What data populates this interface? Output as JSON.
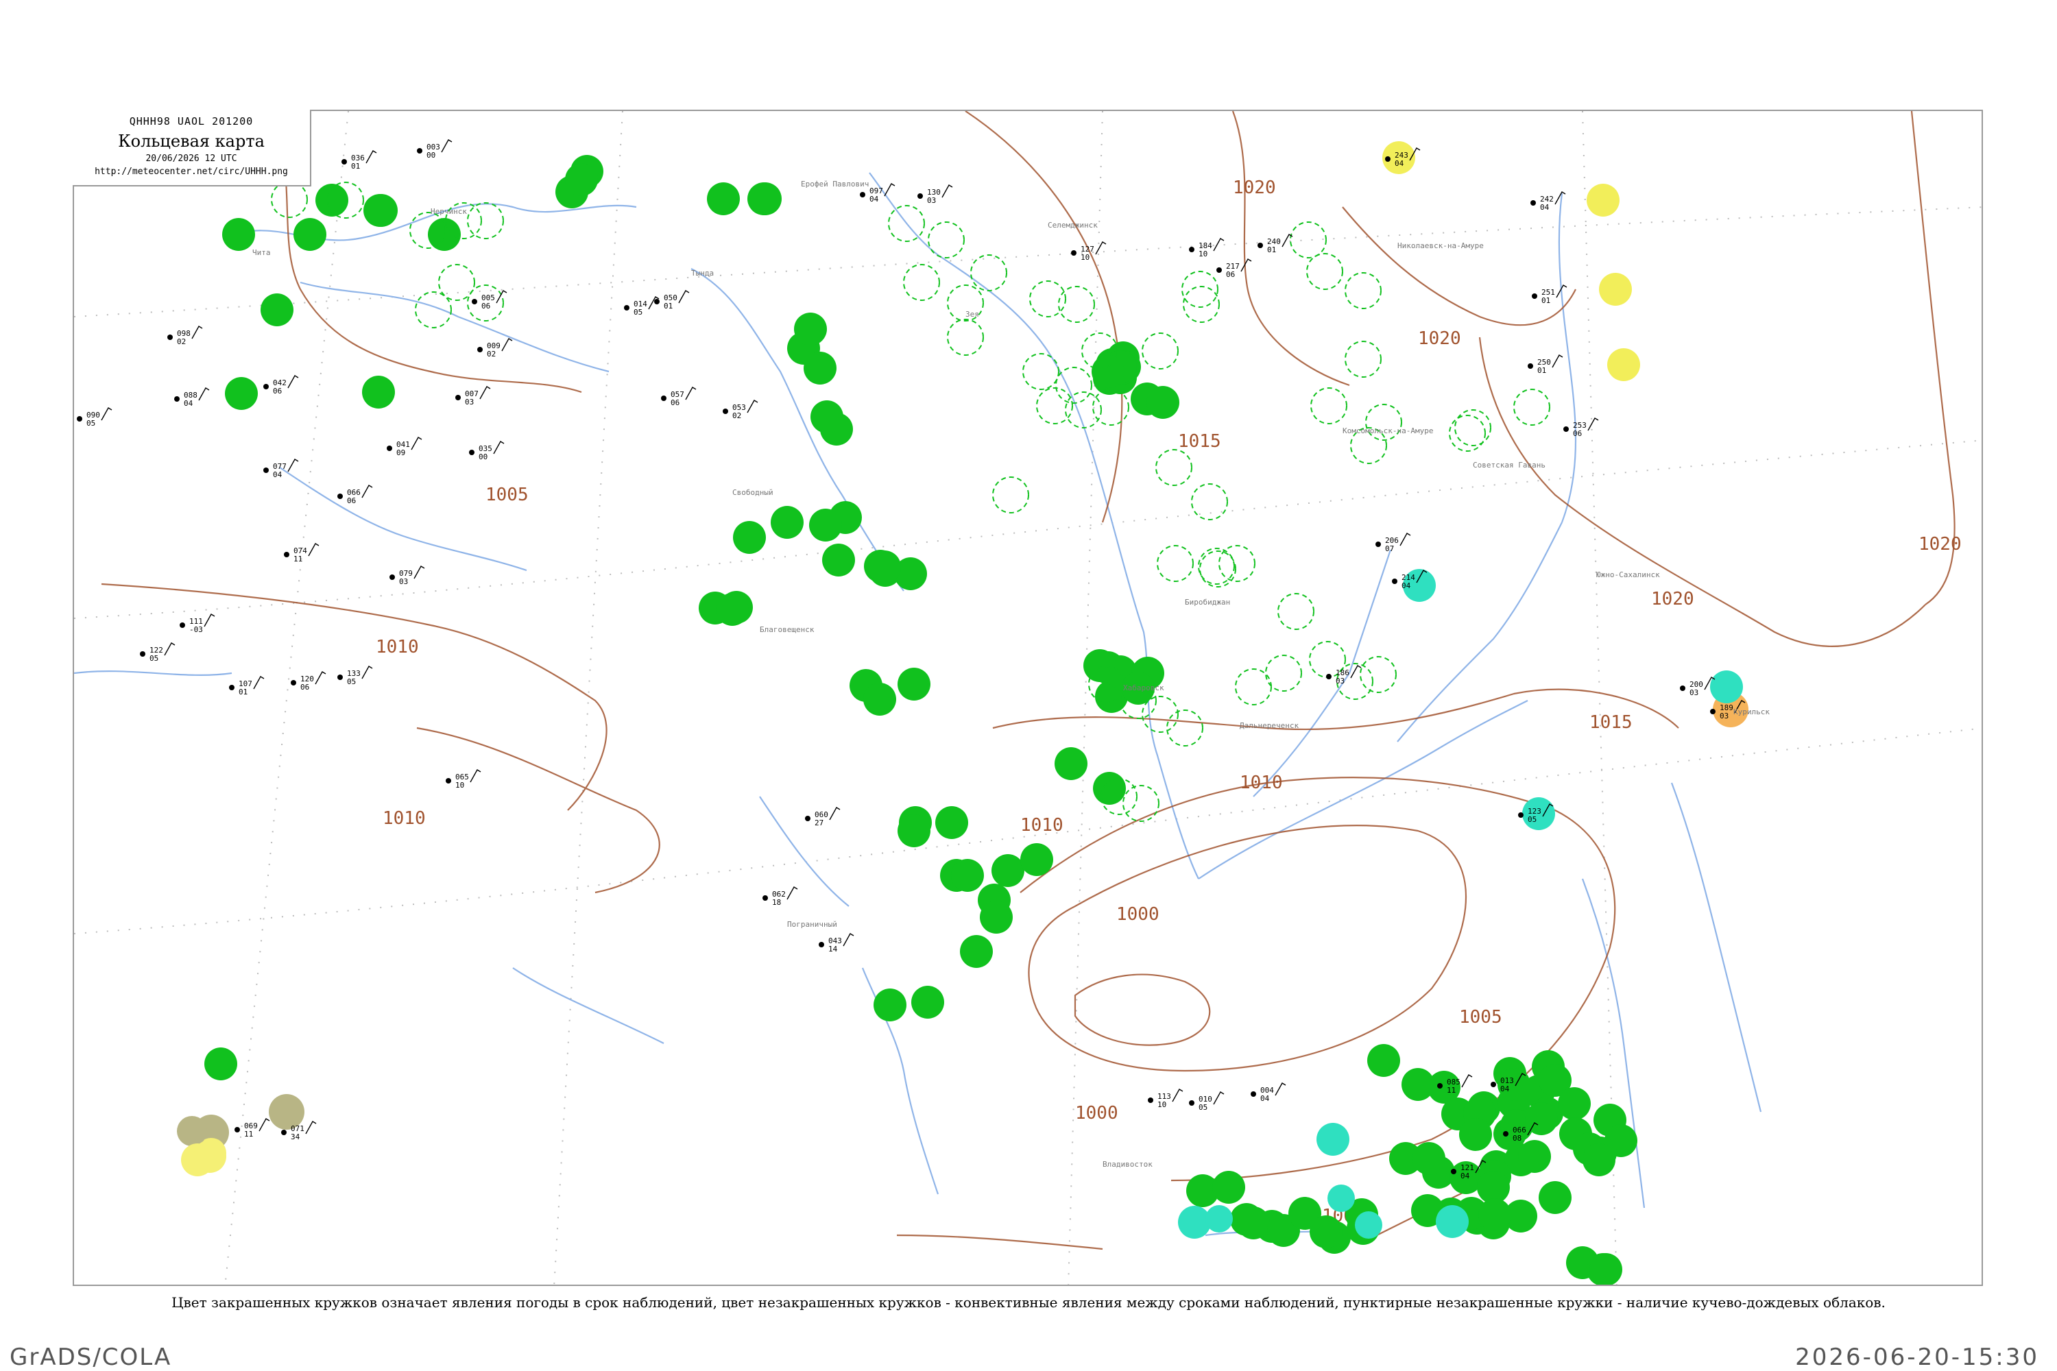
{
  "title": {
    "code": "QHHH98  UAOL  201200",
    "name": "Кольцевая карта",
    "date": "20/06/2026 12 UTC",
    "url": "http://meteocenter.net/circ/UHHH.png"
  },
  "caption": "Цвет закрашенных кружков означает явления погоды в срок наблюдений, цвет незакрашенных кружков - конвективные явления между сроками наблюдений, пунктирные незакрашенные кружки - наличие кучево-дождевых облаков.",
  "footer": {
    "left": "GrADS/COLA",
    "right": "2026-06-20-15:30"
  },
  "colors": {
    "isobar": "#a0522d",
    "river": "#8fb4e8",
    "rain": "#11c11e",
    "shower": "#2fe0c0",
    "fog_yellow": "#f2ee5a",
    "haze_yellow": "#f5f075",
    "dust": "#f5b35a",
    "haze_olive": "#b8b585",
    "convective": "#11c11e"
  },
  "isobars": [
    {
      "label": "1005"
    },
    {
      "label": "1010"
    },
    {
      "label": "1010"
    },
    {
      "label": "1015"
    },
    {
      "label": "1020"
    },
    {
      "label": "1020"
    },
    {
      "label": "1020"
    },
    {
      "label": "1020"
    },
    {
      "label": "1000"
    },
    {
      "label": "1000"
    },
    {
      "label": "1005"
    },
    {
      "label": "1010"
    },
    {
      "label": "1015"
    },
    {
      "label": "1010"
    },
    {
      "label": "1005"
    }
  ],
  "stations": [
    {
      "pressure": "036",
      "tendency": "01"
    },
    {
      "pressure": "005",
      "tendency": "06"
    },
    {
      "pressure": "003",
      "tendency": "00"
    },
    {
      "pressure": "009",
      "tendency": "02"
    },
    {
      "pressure": "098",
      "tendency": "02"
    },
    {
      "pressure": "090",
      "tendency": "05"
    },
    {
      "pressure": "088",
      "tendency": "04"
    },
    {
      "pressure": "042",
      "tendency": "06"
    },
    {
      "pressure": "041",
      "tendency": "09"
    },
    {
      "pressure": "035",
      "tendency": "00"
    },
    {
      "pressure": "007",
      "tendency": "03"
    },
    {
      "pressure": "077",
      "tendency": "04"
    },
    {
      "pressure": "066",
      "tendency": "06"
    },
    {
      "pressure": "074",
      "tendency": "11"
    },
    {
      "pressure": "079",
      "tendency": "03"
    },
    {
      "pressure": "111",
      "tendency": "-03"
    },
    {
      "pressure": "122",
      "tendency": "05"
    },
    {
      "pressure": "133",
      "tendency": "05"
    },
    {
      "pressure": "120",
      "tendency": "06"
    },
    {
      "pressure": "107",
      "tendency": "01"
    },
    {
      "pressure": "065",
      "tendency": "10"
    },
    {
      "pressure": "014",
      "tendency": "05"
    },
    {
      "pressure": "050",
      "tendency": "01"
    },
    {
      "pressure": "057",
      "tendency": "06"
    },
    {
      "pressure": "053",
      "tendency": "02"
    },
    {
      "pressure": "097",
      "tendency": "04"
    },
    {
      "pressure": "130",
      "tendency": "03"
    },
    {
      "pressure": "127",
      "tendency": "10"
    },
    {
      "pressure": "184",
      "tendency": "10"
    },
    {
      "pressure": "240",
      "tendency": "01"
    },
    {
      "pressure": "217",
      "tendency": "06"
    },
    {
      "pressure": "242",
      "tendency": "04"
    },
    {
      "pressure": "243",
      "tendency": "04"
    },
    {
      "pressure": "251",
      "tendency": "01"
    },
    {
      "pressure": "250",
      "tendency": "01"
    },
    {
      "pressure": "253",
      "tendency": "06"
    },
    {
      "pressure": "214",
      "tendency": "04"
    },
    {
      "pressure": "200",
      "tendency": "03"
    },
    {
      "pressure": "189",
      "tendency": "03"
    },
    {
      "pressure": "123",
      "tendency": "05"
    },
    {
      "pressure": "113",
      "tendency": "10"
    },
    {
      "pressure": "010",
      "tendency": "05"
    },
    {
      "pressure": "004",
      "tendency": "04"
    },
    {
      "pressure": "085",
      "tendency": "11"
    },
    {
      "pressure": "013",
      "tendency": "04"
    },
    {
      "pressure": "121",
      "tendency": "04"
    },
    {
      "pressure": "066",
      "tendency": "08"
    },
    {
      "pressure": "069",
      "tendency": "11"
    },
    {
      "pressure": "071",
      "tendency": "34"
    },
    {
      "pressure": "062",
      "tendency": "18"
    },
    {
      "pressure": "060",
      "tendency": "27"
    },
    {
      "pressure": "043",
      "tendency": "14"
    },
    {
      "pressure": "206",
      "tendency": "07"
    },
    {
      "pressure": "186",
      "tendency": "03"
    }
  ],
  "place_names": [
    "Ерофей Павлович",
    "Зея",
    "Свободный",
    "Благовещенск",
    "Хабаровск",
    "Николаевск-на-Амуре",
    "Комсомольск-на-Амуре",
    "Советская Гавань",
    "Владивосток",
    "Южно-Сахалинск",
    "Курильск",
    "Биробиджан",
    "Чита",
    "Нерчинск",
    "Тында",
    "Селемджинск",
    "Дальнереченск",
    "Пограничный"
  ]
}
